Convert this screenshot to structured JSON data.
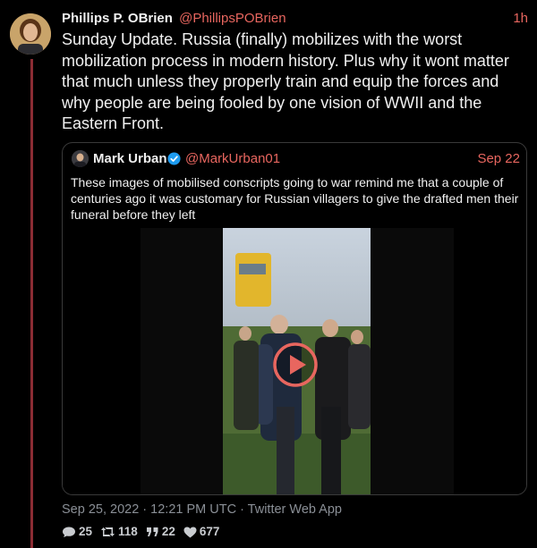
{
  "tweet": {
    "author_name": "Phillips P. OBrien",
    "author_handle": "@PhillipsPOBrien",
    "time": "1h",
    "text": "Sunday Update. Russia (finally) mobilizes with the worst mobilization process in modern history. Plus why it wont matter that much unless they properly train and equip the forces and why people are being fooled by one vision of WWII and the Eastern Front.",
    "meta": "Sep 25, 2022 · 12:21 PM UTC · Twitter Web App",
    "stats": {
      "replies": "25",
      "retweets": "118",
      "quotes": "22",
      "likes": "677"
    }
  },
  "quote": {
    "author_name": "Mark Urban",
    "author_handle": "@MarkUrban01",
    "date": "Sep 22",
    "text": "These images of mobilised conscripts going to war remind me that a couple of centuries ago it was customary for Russian villagers to give the drafted men their funeral before they left"
  },
  "colors": {
    "accent": "#e8665f",
    "thread_line": "#8b2c34",
    "background": "#000000"
  },
  "icons": [
    "reply-icon",
    "retweet-icon",
    "quote-icon",
    "heart-icon",
    "verified-icon",
    "play-icon"
  ]
}
